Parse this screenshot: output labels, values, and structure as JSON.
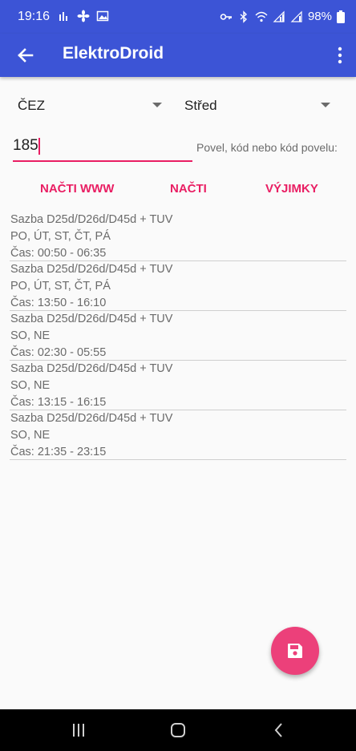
{
  "status_bar": {
    "time": "19:16",
    "battery": "98%"
  },
  "app_bar": {
    "title": "ElektroDroid"
  },
  "form": {
    "provider_select": "ČEZ",
    "region_select": "Střed",
    "code_input_value": "185",
    "code_hint": "Povel, kód nebo kód povelu:"
  },
  "actions": {
    "load_www": "NAČTI WWW",
    "load": "NAČTI",
    "exceptions": "VÝJIMKY"
  },
  "results": [
    {
      "tariff": "Sazba D25d/D26d/D45d + TUV",
      "days": "PO, ÚT, ST, ČT, PÁ",
      "time": "Čas: 00:50 - 06:35"
    },
    {
      "tariff": "Sazba D25d/D26d/D45d + TUV",
      "days": "PO, ÚT, ST, ČT, PÁ",
      "time": "Čas: 13:50 - 16:10"
    },
    {
      "tariff": "Sazba D25d/D26d/D45d + TUV",
      "days": "SO, NE",
      "time": "Čas: 02:30 - 05:55"
    },
    {
      "tariff": "Sazba D25d/D26d/D45d + TUV",
      "days": "SO, NE",
      "time": "Čas: 13:15 - 16:15"
    },
    {
      "tariff": "Sazba D25d/D26d/D45d + TUV",
      "days": "SO, NE",
      "time": "Čas: 21:35 - 23:15"
    }
  ],
  "colors": {
    "app_bar": "#3c54d6",
    "accent": "#e91e63",
    "fab": "#ec407a"
  },
  "icons": {
    "fab": "save-icon",
    "back": "arrow-back-icon",
    "menu": "more-vert-icon"
  }
}
